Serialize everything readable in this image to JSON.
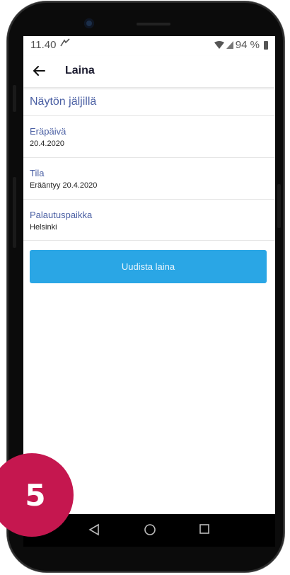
{
  "status_bar": {
    "time": "11.40",
    "notification_icon": "notification-icon",
    "battery_level": "94 %"
  },
  "app_bar": {
    "back_icon": "back-arrow-icon",
    "title": "Laina"
  },
  "loan": {
    "section_title": "Näytön jäljillä",
    "fields": [
      {
        "label": "Eräpäivä",
        "value": "20.4.2020"
      },
      {
        "label": "Tila",
        "value": "Erääntyy 20.4.2020"
      },
      {
        "label": "Palautuspaikka",
        "value": "Helsinki"
      }
    ],
    "renew_button": "Uudista laina"
  },
  "navigation_bar": {
    "icons": [
      "back-triangle-icon",
      "home-circle-icon",
      "recents-square-icon"
    ]
  },
  "step_badge": {
    "number": "5"
  },
  "colors": {
    "accent_text": "#4a5fa3",
    "button": "#2aa6e5",
    "badge": "#c5174f"
  }
}
